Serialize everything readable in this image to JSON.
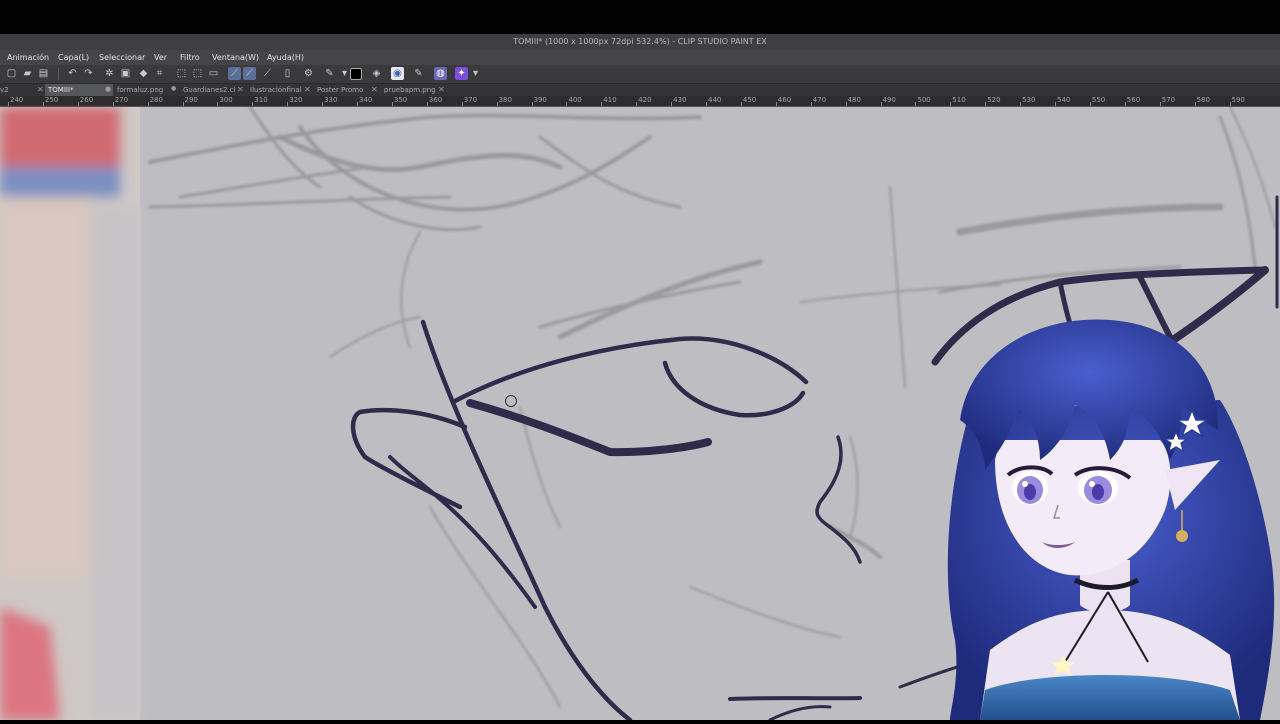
{
  "window": {
    "title": "TOMIII* (1000 x 1000px 72dpi 532.4%) - CLIP STUDIO PAINT EX"
  },
  "menu": {
    "items": [
      "Animación",
      "Capa(L)",
      "Seleccionar",
      "Ver",
      "Filtro",
      "Ventana(W)",
      "Ayuda(H)"
    ]
  },
  "tabs": [
    {
      "label": "v2"
    },
    {
      "label": "TOMIII*",
      "active": true
    },
    {
      "label": "formaluz.png"
    },
    {
      "label": "Guardianes2.cl"
    },
    {
      "label": "Ilustraciónfinal"
    },
    {
      "label": "Poster Promo"
    },
    {
      "label": "pruebapm.png"
    }
  ],
  "ruler": {
    "labels": [
      "240",
      "250",
      "260",
      "270",
      "280",
      "290",
      "300",
      "310",
      "320",
      "330",
      "340",
      "350",
      "360",
      "370",
      "380",
      "390",
      "400",
      "410",
      "420",
      "430",
      "440",
      "450",
      "460",
      "470",
      "480",
      "490",
      "500",
      "510",
      "520",
      "530",
      "540",
      "550",
      "560",
      "570",
      "580",
      "590"
    ]
  },
  "colors": {
    "canvas": "#bebdc1",
    "lineart": "#2e2c4a",
    "sketch": "#8e8d92",
    "avatar_hair": "#2b3a9c",
    "accent_purple": "#7b4fd9"
  },
  "icons": [
    "new-file-icon",
    "open-folder-icon",
    "save-icon",
    "undo-icon",
    "redo-icon",
    "loading-icon",
    "fill-icon",
    "transform-icon",
    "pen-icon",
    "eyedropper-icon",
    "color-swatch-icon",
    "eraser-icon"
  ]
}
